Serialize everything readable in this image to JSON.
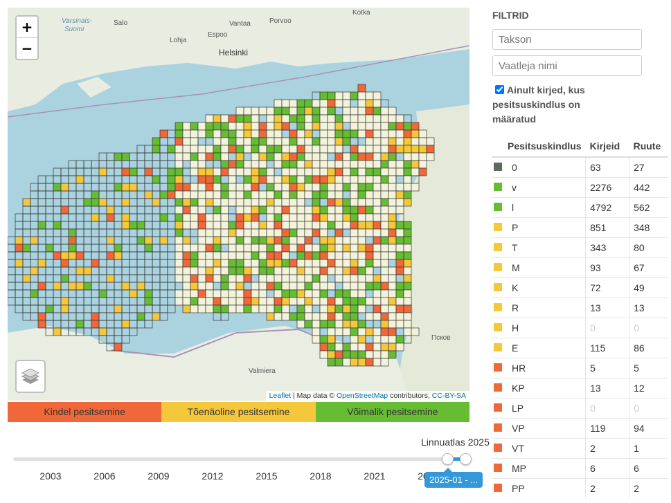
{
  "map": {
    "zoom_in": "+",
    "zoom_out": "−",
    "layers_icon": "layers-icon",
    "attribution": {
      "leaflet": "Leaflet",
      "sep": " | Map data © ",
      "osm": "OpenStreetMap",
      "contrib": " contributors, ",
      "license": "CC-BY-SA"
    },
    "places": {
      "varsinais": "Varsinais-",
      "suomi": "Suomi",
      "salo": "Salo",
      "lohja": "Lohja",
      "espoo": "Espoo",
      "vantaa": "Vantaa",
      "porvoo": "Porvoo",
      "kotka": "Kotka",
      "helsinki": "Helsinki",
      "valmiera": "Valmiera",
      "pskov": "Псков"
    },
    "cell_colors": {
      "grid": "#333333",
      "fill": "#f3f3dc",
      "certain": "#f0683a",
      "probable": "#f5c73a",
      "possible": "#66bd33"
    }
  },
  "legend": [
    {
      "label": "Kindel pesitsemine",
      "color": "#f0683a"
    },
    {
      "label": "Tõenäoline pesitsemine",
      "color": "#f5c73a"
    },
    {
      "label": "Võimalik pesitsemine",
      "color": "#66bd33"
    }
  ],
  "timeline": {
    "title": "Linnuatlas 2025",
    "ticks": [
      "2003",
      "2006",
      "2009",
      "2012",
      "2015",
      "2018",
      "2021",
      "20"
    ],
    "range_label": "2025-01 - ..."
  },
  "filters": {
    "title": "FILTRID",
    "taxon_placeholder": "Takson",
    "observer_placeholder": "Vaatleja nimi",
    "checkbox_label": "Ainult kirjed, kus pesitsuskindlus on määratud"
  },
  "table": {
    "headers": [
      "Pesitsuskindlus",
      "Kirjeid",
      "Ruute"
    ],
    "rows": [
      {
        "color": "#5f6a5f",
        "code": "0",
        "records": "63",
        "squares": "27"
      },
      {
        "color": "#66bd33",
        "code": "v",
        "records": "2276",
        "squares": "442"
      },
      {
        "color": "#66bd33",
        "code": "l",
        "records": "4792",
        "squares": "562"
      },
      {
        "color": "#f5c73a",
        "code": "P",
        "records": "851",
        "squares": "348"
      },
      {
        "color": "#f5c73a",
        "code": "T",
        "records": "343",
        "squares": "80"
      },
      {
        "color": "#f5c73a",
        "code": "M",
        "records": "93",
        "squares": "67"
      },
      {
        "color": "#f5c73a",
        "code": "K",
        "records": "72",
        "squares": "49"
      },
      {
        "color": "#f5c73a",
        "code": "R",
        "records": "13",
        "squares": "13"
      },
      {
        "color": "#f5c73a",
        "code": "H",
        "records": "0",
        "squares": "0"
      },
      {
        "color": "#f5c73a",
        "code": "E",
        "records": "115",
        "squares": "86"
      },
      {
        "color": "#f0683a",
        "code": "HR",
        "records": "5",
        "squares": "5"
      },
      {
        "color": "#f0683a",
        "code": "KP",
        "records": "13",
        "squares": "12"
      },
      {
        "color": "#f0683a",
        "code": "LP",
        "records": "0",
        "squares": "0"
      },
      {
        "color": "#f0683a",
        "code": "VP",
        "records": "119",
        "squares": "94"
      },
      {
        "color": "#f0683a",
        "code": "VT",
        "records": "2",
        "squares": "1"
      },
      {
        "color": "#f0683a",
        "code": "MP",
        "records": "6",
        "squares": "6"
      },
      {
        "color": "#f0683a",
        "code": "PP",
        "records": "2",
        "squares": "2"
      }
    ]
  }
}
